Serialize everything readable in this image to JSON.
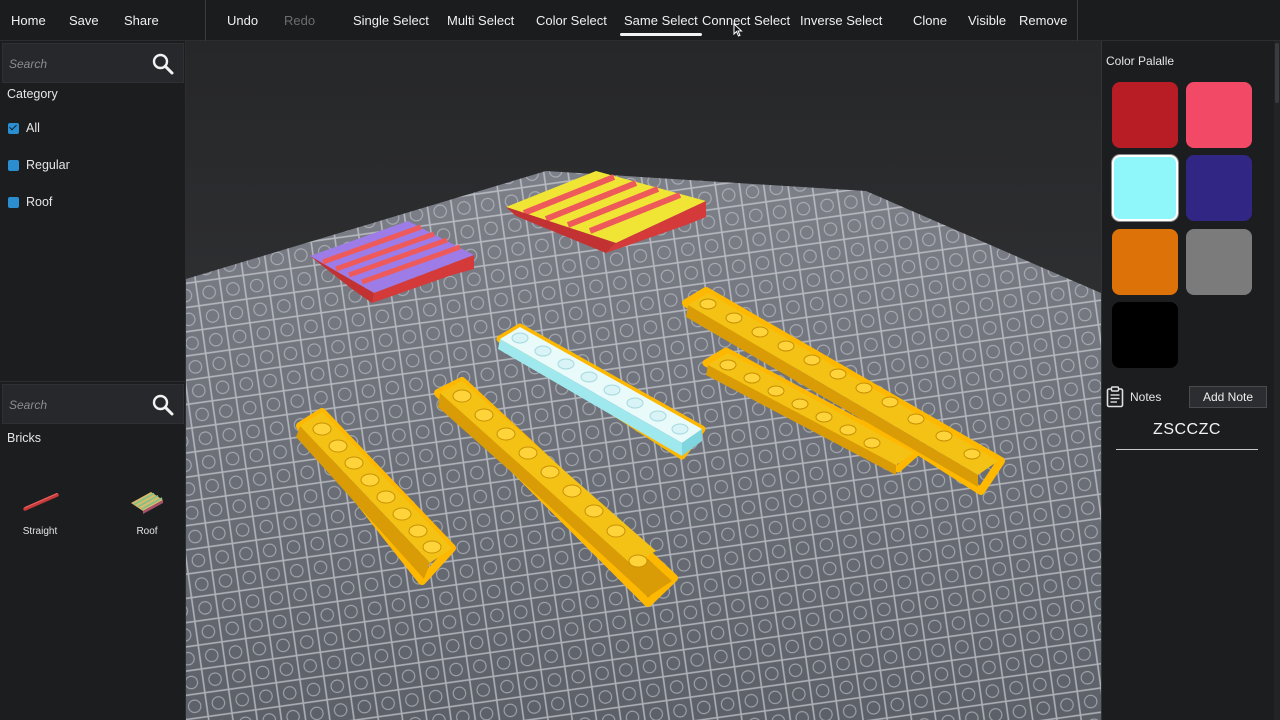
{
  "toolbar": {
    "home": "Home",
    "save": "Save",
    "share": "Share",
    "undo": "Undo",
    "redo": "Redo",
    "single_select": "Single Select",
    "multi_select": "Multi Select",
    "color_select": "Color Select",
    "same_select": "Same Select",
    "connect_select": "Connect Select",
    "inverse_select": "Inverse Select",
    "clone": "Clone",
    "visible": "Visible",
    "remove": "Remove",
    "active_tool": "Same Select"
  },
  "left_panel": {
    "category_search": {
      "placeholder": "Search",
      "value": ""
    },
    "category_title": "Category",
    "categories": [
      {
        "label": "All",
        "checked": true
      },
      {
        "label": "Regular",
        "checked": false
      },
      {
        "label": "Roof",
        "checked": false
      }
    ],
    "brick_search": {
      "placeholder": "Search",
      "value": ""
    },
    "bricks_title": "Bricks",
    "bricks": [
      {
        "label": "Straight",
        "icon": "straight-brick-icon"
      },
      {
        "label": "Roof",
        "icon": "roof-brick-icon"
      }
    ]
  },
  "right_panel": {
    "palette_title": "Color Palalle",
    "palette": [
      {
        "color": "#b81c24",
        "selected": false
      },
      {
        "color": "#f24a66",
        "selected": false
      },
      {
        "color": "#8ff7f9",
        "selected": true
      },
      {
        "color": "#312683",
        "selected": false
      },
      {
        "color": "#dd7208",
        "selected": false
      },
      {
        "color": "#7b7b7b",
        "selected": false
      },
      {
        "color": "#000000",
        "selected": false
      }
    ],
    "notes_label": "Notes",
    "notes_icon": "clipboard-icon",
    "add_note_label": "Add Note",
    "note_text": "ZSCCZC"
  },
  "colors": {
    "brick_yellow": "#f3c214",
    "selection_outline": "#ffb800",
    "brick_white": "#e8fafa",
    "roof_red": "#ee5a59",
    "roof_yellow": "#f0e535",
    "roof_violet": "#9d7ce8"
  }
}
